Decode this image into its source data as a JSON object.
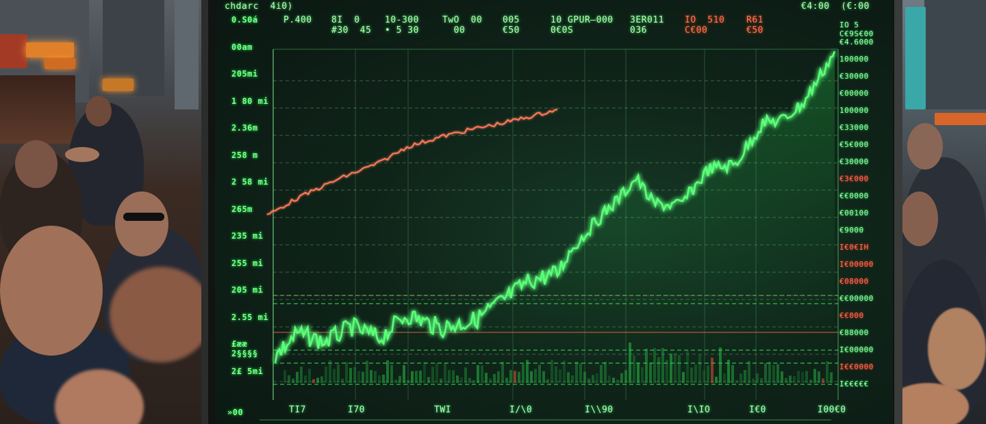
{
  "screen": {
    "header_left": "chdarc  4i0)",
    "header_items": [
      "P.400",
      "8I  0\n#30  45",
      "10-300\n• 5 30",
      "TwO  00\n  00",
      "005\n€50",
      "10 GPUR–000\n0€0S",
      "3ER011\n036",
      "IO  510\nC€00",
      "R61\n€50"
    ],
    "header_right": "€4:00  (€:00",
    "y_labels": [
      "0.S0á",
      "00am",
      "205mi",
      "1 80 mi",
      "2.36m",
      "258 m",
      "2 58 mi",
      "265m",
      "235 mi",
      "255 mi",
      "205 mi",
      "2.55 mi",
      "£ææ\n2§§§§",
      "2£ 5mi"
    ],
    "right_labels": [
      {
        "t": "IO 5\nC€9S€00",
        "red": false
      },
      {
        "t": "€4.6000",
        "red": false
      },
      {
        "t": "100000",
        "red": false
      },
      {
        "t": "€30000",
        "red": false
      },
      {
        "t": "€00000",
        "red": false
      },
      {
        "t": "100000",
        "red": false
      },
      {
        "t": "€33000",
        "red": false
      },
      {
        "t": "€5€000",
        "red": false
      },
      {
        "t": "€30000",
        "red": false
      },
      {
        "t": "€3€000",
        "red": true
      },
      {
        "t": "€€0000",
        "red": false
      },
      {
        "t": "€00100",
        "red": false
      },
      {
        "t": "€9000",
        "red": false
      },
      {
        "t": "I€0€IH",
        "red": true
      },
      {
        "t": "I€00000",
        "red": true
      },
      {
        "t": "€08000",
        "red": true
      },
      {
        "t": "€€00000",
        "red": false
      },
      {
        "t": "€€000",
        "red": true
      },
      {
        "t": "€88000",
        "red": false
      },
      {
        "t": "I€00000",
        "red": false
      },
      {
        "t": "I€€0000",
        "red": true
      },
      {
        "t": "I€€€€€",
        "red": false
      }
    ],
    "x_labels": [
      "TI7",
      "I70",
      "TWI",
      "I/\\0",
      "I\\\\90",
      "I\\IO",
      "I€0",
      "I00€0"
    ],
    "bottom_left": "»00",
    "colors": {
      "green": "#36ff5a",
      "red": "#ff6e4a"
    }
  }
}
